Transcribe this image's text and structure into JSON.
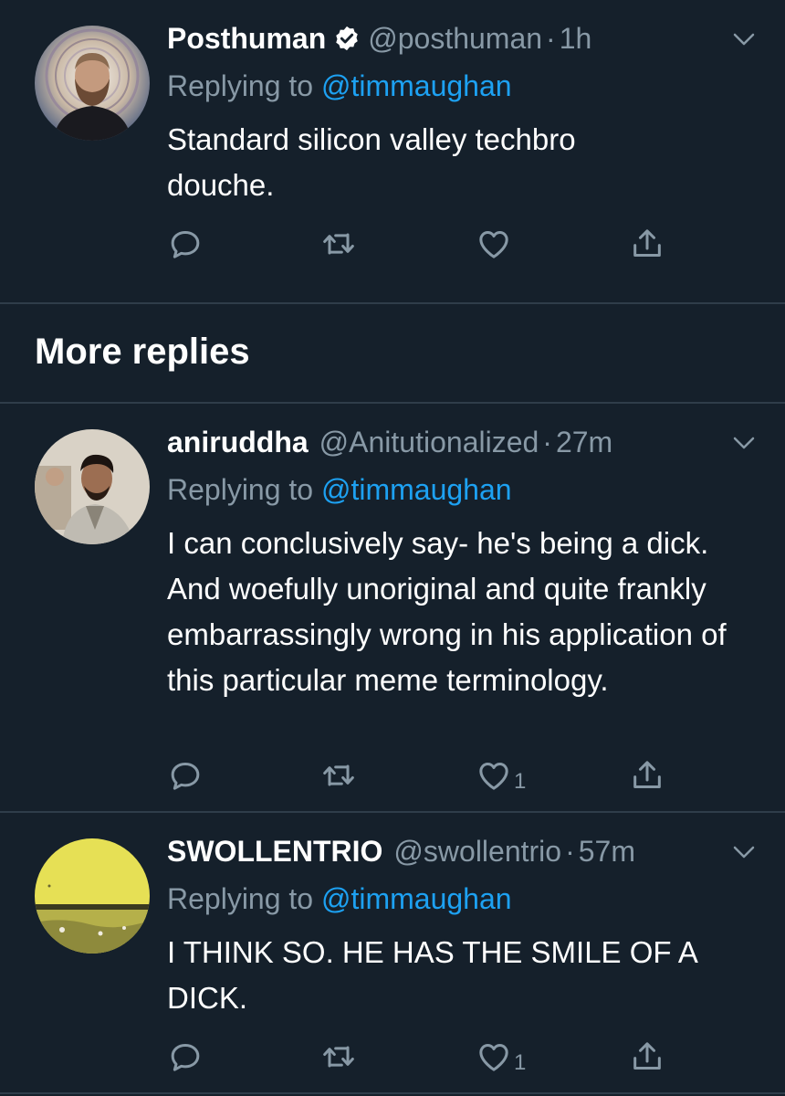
{
  "tweets": [
    {
      "display_name": "Posthuman",
      "verified": true,
      "handle": "@posthuman",
      "separator": "·",
      "time": "1h",
      "replying_prefix": "Replying to ",
      "replying_to": "@timmaughan",
      "text": "Standard silicon valley techbro douche.",
      "likes": ""
    },
    {
      "display_name": "aniruddha",
      "verified": false,
      "handle": "@Anitutionalized",
      "separator": "·",
      "time": "27m",
      "replying_prefix": "Replying to ",
      "replying_to": "@timmaughan",
      "text": "I can conclusively say- he's being a dick. And woefully unoriginal and quite frankly embarrassingly wrong in his application of this particular meme terminology.",
      "likes": "1"
    },
    {
      "display_name": "SWOLLENTRIO",
      "verified": false,
      "handle": "@swollentrio",
      "separator": "·",
      "time": "57m",
      "replying_prefix": "Replying to ",
      "replying_to": "@timmaughan",
      "text": "I THINK SO. HE HAS THE SMILE OF A DICK.",
      "likes": "1"
    }
  ],
  "section": {
    "more_replies": "More replies"
  },
  "colors": {
    "background": "#15202b",
    "secondary_text": "#8899a6",
    "accent": "#1da1f2",
    "divider": "#2f3d4a"
  },
  "icons": [
    "reply-icon",
    "retweet-icon",
    "like-icon",
    "share-icon",
    "chevron-down-icon",
    "verified-badge-icon"
  ]
}
